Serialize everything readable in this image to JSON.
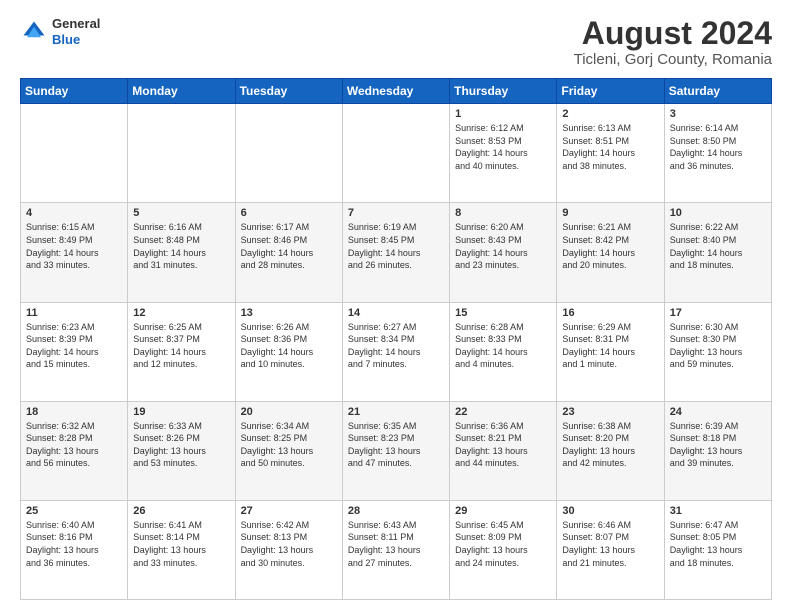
{
  "header": {
    "logo_general": "General",
    "logo_blue": "Blue",
    "title": "August 2024",
    "subtitle": "Ticleni, Gorj County, Romania"
  },
  "weekdays": [
    "Sunday",
    "Monday",
    "Tuesday",
    "Wednesday",
    "Thursday",
    "Friday",
    "Saturday"
  ],
  "rows": [
    [
      {
        "day": "",
        "info": ""
      },
      {
        "day": "",
        "info": ""
      },
      {
        "day": "",
        "info": ""
      },
      {
        "day": "",
        "info": ""
      },
      {
        "day": "1",
        "info": "Sunrise: 6:12 AM\nSunset: 8:53 PM\nDaylight: 14 hours\nand 40 minutes."
      },
      {
        "day": "2",
        "info": "Sunrise: 6:13 AM\nSunset: 8:51 PM\nDaylight: 14 hours\nand 38 minutes."
      },
      {
        "day": "3",
        "info": "Sunrise: 6:14 AM\nSunset: 8:50 PM\nDaylight: 14 hours\nand 36 minutes."
      }
    ],
    [
      {
        "day": "4",
        "info": "Sunrise: 6:15 AM\nSunset: 8:49 PM\nDaylight: 14 hours\nand 33 minutes."
      },
      {
        "day": "5",
        "info": "Sunrise: 6:16 AM\nSunset: 8:48 PM\nDaylight: 14 hours\nand 31 minutes."
      },
      {
        "day": "6",
        "info": "Sunrise: 6:17 AM\nSunset: 8:46 PM\nDaylight: 14 hours\nand 28 minutes."
      },
      {
        "day": "7",
        "info": "Sunrise: 6:19 AM\nSunset: 8:45 PM\nDaylight: 14 hours\nand 26 minutes."
      },
      {
        "day": "8",
        "info": "Sunrise: 6:20 AM\nSunset: 8:43 PM\nDaylight: 14 hours\nand 23 minutes."
      },
      {
        "day": "9",
        "info": "Sunrise: 6:21 AM\nSunset: 8:42 PM\nDaylight: 14 hours\nand 20 minutes."
      },
      {
        "day": "10",
        "info": "Sunrise: 6:22 AM\nSunset: 8:40 PM\nDaylight: 14 hours\nand 18 minutes."
      }
    ],
    [
      {
        "day": "11",
        "info": "Sunrise: 6:23 AM\nSunset: 8:39 PM\nDaylight: 14 hours\nand 15 minutes."
      },
      {
        "day": "12",
        "info": "Sunrise: 6:25 AM\nSunset: 8:37 PM\nDaylight: 14 hours\nand 12 minutes."
      },
      {
        "day": "13",
        "info": "Sunrise: 6:26 AM\nSunset: 8:36 PM\nDaylight: 14 hours\nand 10 minutes."
      },
      {
        "day": "14",
        "info": "Sunrise: 6:27 AM\nSunset: 8:34 PM\nDaylight: 14 hours\nand 7 minutes."
      },
      {
        "day": "15",
        "info": "Sunrise: 6:28 AM\nSunset: 8:33 PM\nDaylight: 14 hours\nand 4 minutes."
      },
      {
        "day": "16",
        "info": "Sunrise: 6:29 AM\nSunset: 8:31 PM\nDaylight: 14 hours\nand 1 minute."
      },
      {
        "day": "17",
        "info": "Sunrise: 6:30 AM\nSunset: 8:30 PM\nDaylight: 13 hours\nand 59 minutes."
      }
    ],
    [
      {
        "day": "18",
        "info": "Sunrise: 6:32 AM\nSunset: 8:28 PM\nDaylight: 13 hours\nand 56 minutes."
      },
      {
        "day": "19",
        "info": "Sunrise: 6:33 AM\nSunset: 8:26 PM\nDaylight: 13 hours\nand 53 minutes."
      },
      {
        "day": "20",
        "info": "Sunrise: 6:34 AM\nSunset: 8:25 PM\nDaylight: 13 hours\nand 50 minutes."
      },
      {
        "day": "21",
        "info": "Sunrise: 6:35 AM\nSunset: 8:23 PM\nDaylight: 13 hours\nand 47 minutes."
      },
      {
        "day": "22",
        "info": "Sunrise: 6:36 AM\nSunset: 8:21 PM\nDaylight: 13 hours\nand 44 minutes."
      },
      {
        "day": "23",
        "info": "Sunrise: 6:38 AM\nSunset: 8:20 PM\nDaylight: 13 hours\nand 42 minutes."
      },
      {
        "day": "24",
        "info": "Sunrise: 6:39 AM\nSunset: 8:18 PM\nDaylight: 13 hours\nand 39 minutes."
      }
    ],
    [
      {
        "day": "25",
        "info": "Sunrise: 6:40 AM\nSunset: 8:16 PM\nDaylight: 13 hours\nand 36 minutes."
      },
      {
        "day": "26",
        "info": "Sunrise: 6:41 AM\nSunset: 8:14 PM\nDaylight: 13 hours\nand 33 minutes."
      },
      {
        "day": "27",
        "info": "Sunrise: 6:42 AM\nSunset: 8:13 PM\nDaylight: 13 hours\nand 30 minutes."
      },
      {
        "day": "28",
        "info": "Sunrise: 6:43 AM\nSunset: 8:11 PM\nDaylight: 13 hours\nand 27 minutes."
      },
      {
        "day": "29",
        "info": "Sunrise: 6:45 AM\nSunset: 8:09 PM\nDaylight: 13 hours\nand 24 minutes."
      },
      {
        "day": "30",
        "info": "Sunrise: 6:46 AM\nSunset: 8:07 PM\nDaylight: 13 hours\nand 21 minutes."
      },
      {
        "day": "31",
        "info": "Sunrise: 6:47 AM\nSunset: 8:05 PM\nDaylight: 13 hours\nand 18 minutes."
      }
    ]
  ]
}
